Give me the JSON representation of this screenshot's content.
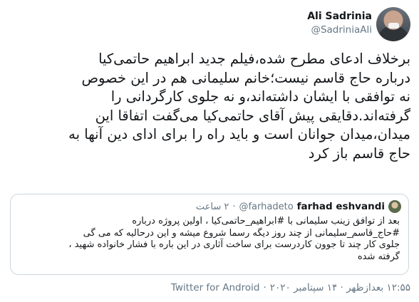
{
  "author": {
    "display_name": "Ali Sadrinia",
    "handle": "@SadriniaAli"
  },
  "tweet": {
    "text": "برخلاف ادعای مطرح شده،فیلم جدید ابراهیم حاتمی‌کیا\nدرباره حاج قاسم نیست؛خانم سلیمانی هم در این خصوص\nنه توافقی با ایشان داشته‌اند،و نه جلوی کارگردانی را\nگرفته‌اند.دقایقی پیش آقای حاتمی‌کیا می‌گفت اتفاقا این\nمیدان،میدان جوانان است و باید راه را برای ادای دین آنها به\nحاج قاسم باز کرد"
  },
  "quoted": {
    "display_name": "farhad eshvandi",
    "handle": "@farhadeto",
    "separator": "·",
    "time": "۲ ساعت",
    "text": "بعد از توافق زینب سلیمانی با #ابراهیم_حاتمی‌کیا ، اولین پروژه درباره\n#حاج_قاسم_سلیمانی از چند روز دیگه رسما شروع میشه و این درحالیه که می گی\nجلوی کار چند تا جوون کاردرست برای ساخت آثاری در این باره با فشار خانواده شهید ،\nگرفته شده"
  },
  "meta": {
    "time": "۱۲:۵۵ بعدازظهر · ۱۴ سپتامبر ۲۰۲۰",
    "separator": "·",
    "source": "Twitter for Android"
  }
}
